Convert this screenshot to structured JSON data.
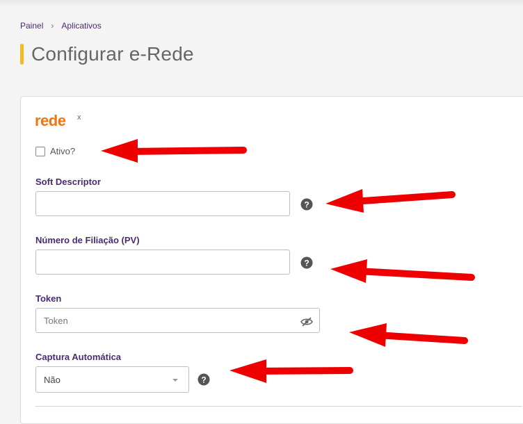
{
  "breadcrumb": {
    "home": "Painel",
    "current": "Aplicativos"
  },
  "page": {
    "title": "Configurar e-Rede"
  },
  "brand": {
    "logo_text": "rede",
    "logo_mark": "x"
  },
  "form": {
    "active_label": "Ativo?",
    "active_checked": false,
    "soft_descriptor": {
      "label": "Soft Descriptor",
      "value": ""
    },
    "affiliation_number": {
      "label": "Número de Filiação (PV)",
      "value": ""
    },
    "token": {
      "label": "Token",
      "placeholder": "Token",
      "value": ""
    },
    "auto_capture": {
      "label": "Captura Automática",
      "selected": "Não"
    }
  },
  "colors": {
    "accent_title_bar": "#f5b921",
    "brand_orange": "#f0750f",
    "label_purple": "#4b2a72",
    "annotation_red": "#ee0000"
  },
  "icons": [
    "help-circle-icon",
    "eye-slash-icon",
    "chevron-down-icon"
  ]
}
